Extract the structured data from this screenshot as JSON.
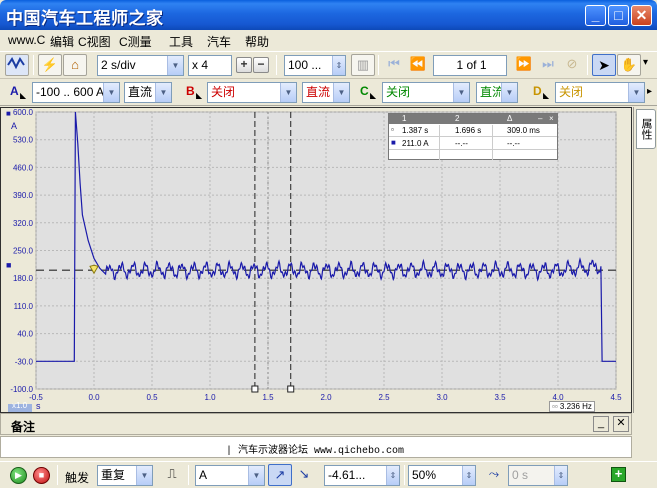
{
  "window": {
    "title": "中国汽车工程师之家",
    "minimize_glyph": "_",
    "maximize_glyph": "□",
    "close_glyph": "✕"
  },
  "menu": [
    "www.C",
    "编辑",
    "C视图",
    "C测量",
    "工具",
    "汽车",
    "帮助"
  ],
  "toolbar": {
    "timebase": "2 s/div",
    "zoom": "x 4",
    "samples": "100 ...",
    "page": "1 of 1"
  },
  "channels": {
    "a": {
      "letter": "A",
      "range": "-100 .. 600 A",
      "coupling": "直流"
    },
    "b": {
      "letter": "B",
      "range": "关闭",
      "coupling": "直流"
    },
    "c": {
      "letter": "C",
      "range": "关闭",
      "coupling": "直流"
    },
    "d": {
      "letter": "D",
      "range": "关闭"
    }
  },
  "sidebar": {
    "tab_label": "属性"
  },
  "measure_table": {
    "headers": [
      "",
      "1",
      "2",
      "Δ"
    ],
    "rows": [
      [
        "",
        "1.387 s",
        "1.696 s",
        "309.0 ms"
      ],
      [
        "",
        "211.0 A",
        "--.--",
        "--.--"
      ]
    ]
  },
  "chart_data": {
    "type": "line",
    "title": "",
    "xlabel": "s",
    "ylabel": "A",
    "xlim": [
      -0.5,
      4.5
    ],
    "ylim": [
      -100,
      600
    ],
    "x_ticks": [
      "-0.5",
      "0.0",
      "0.5",
      "1.0",
      "1.5",
      "2.0",
      "2.5",
      "3.0",
      "3.5",
      "4.0",
      "4.5"
    ],
    "y_ticks": [
      "600.0",
      "530.0",
      "460.0",
      "390.0",
      "320.0",
      "250.0",
      "180.0",
      "110.0",
      "40.0",
      "-30.0",
      "-100.0"
    ],
    "series": [
      {
        "color": "#1a1aaa",
        "x": [
          -0.5,
          -0.17,
          -0.16,
          -0.14,
          -0.12,
          -0.1,
          -0.05,
          0.0,
          0.05,
          0.1,
          0.2,
          0.5,
          1.0,
          1.5,
          2.0,
          2.5,
          3.0,
          3.5,
          4.0,
          4.37,
          4.38,
          4.5
        ],
        "y": [
          -30,
          -30,
          600,
          520,
          420,
          340,
          275,
          230,
          205,
          195,
          200,
          200,
          200,
          200,
          200,
          200,
          200,
          200,
          200,
          210,
          -30,
          -30
        ]
      }
    ],
    "cursor_x": [
      1.387,
      1.696
    ],
    "cursor_x_extra": 1.5,
    "grid": true,
    "trigger_level": 200,
    "freq_readout": "3.236 Hz",
    "scale_badge": "x1.0"
  },
  "notes": {
    "title": "备注",
    "text": "| 汽车示波器论坛  www.qichebo.com"
  },
  "status": {
    "trigger_label": "触发",
    "trigger_mode": "重复",
    "trigger_channel": "A",
    "trigger_level": "-4.61...",
    "pretrigger": "50%",
    "delay": "0 s"
  }
}
